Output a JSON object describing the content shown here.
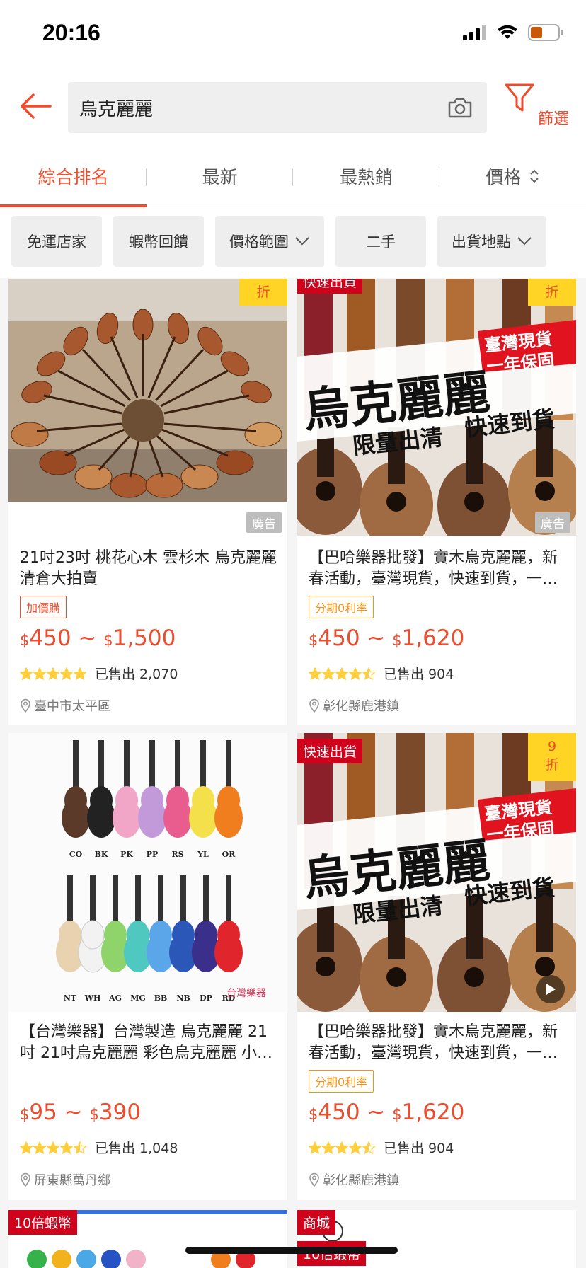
{
  "status_bar": {
    "time": "20:16"
  },
  "search": {
    "query": "烏克麗麗",
    "filter_label": "篩選"
  },
  "sort_tabs": [
    {
      "label": "綜合排名"
    },
    {
      "label": "最新"
    },
    {
      "label": "最熱銷"
    },
    {
      "label": "價格"
    }
  ],
  "chips": [
    {
      "label": "免運店家"
    },
    {
      "label": "蝦幣回饋"
    },
    {
      "label": "價格範圍"
    },
    {
      "label": "二手"
    },
    {
      "label": "出貨地點"
    }
  ],
  "products": [
    {
      "title": "21吋23吋 桃花心木 雲杉木 烏克麗麗 清倉大拍賣",
      "discount_flag": "折",
      "ad_label": "廣告",
      "tag": "加價購",
      "price_currency_1": "$",
      "price_min": "450",
      "price_sep": " ~ ",
      "price_currency_2": "$",
      "price_max": "1,500",
      "rating": 5,
      "sold": "已售出 2,070",
      "location": "臺中市太平區"
    },
    {
      "title": "【巴哈樂器批發】實木烏克麗麗，新春活動，臺灣現貨，快速到貨，一年保固",
      "top_badge": "快速出貨",
      "discount_flag": "折",
      "ad_label": "廣告",
      "banner_big": "烏克麗麗",
      "banner_red_1": "臺灣現貨",
      "banner_red_2": "一年保固",
      "banner_sub_1": "限量出清",
      "banner_sub_2": "快速到貨",
      "tag": "分期0利率",
      "price_currency_1": "$",
      "price_min": "450",
      "price_sep": " ~ ",
      "price_currency_2": "$",
      "price_max": "1,620",
      "rating": 4.5,
      "sold": "已售出 904",
      "location": "彰化縣鹿港鎮"
    },
    {
      "title": "【台灣樂器】台灣製造 烏克麗麗 21吋 21吋烏克麗麗 彩色烏克麗麗 小吉他",
      "color_codes_top": [
        "CO",
        "BK",
        "PK",
        "PP",
        "RS",
        "YL",
        "OR"
      ],
      "color_codes_bottom": [
        "NT",
        "WH",
        "AG",
        "MG",
        "BB",
        "NB",
        "DP",
        "RD"
      ],
      "brand_mark": "台灣樂器",
      "price_currency_1": "$",
      "price_min": "95",
      "price_sep": " ~ ",
      "price_currency_2": "$",
      "price_max": "390",
      "rating": 4.5,
      "sold": "已售出 1,048",
      "location": "屏東縣萬丹鄉"
    },
    {
      "title": "【巴哈樂器批發】實木烏克麗麗，新春活動，臺灣現貨，快速到貨，一年保固",
      "top_badge": "快速出貨",
      "discount_flag_num": "9",
      "discount_flag": "折",
      "banner_big": "烏克麗麗",
      "banner_red_1": "臺灣現貨",
      "banner_red_2": "一年保固",
      "banner_sub_1": "限量出清",
      "banner_sub_2": "快速到貨",
      "tag": "分期0利率",
      "price_currency_1": "$",
      "price_min": "450",
      "price_sep": " ~ ",
      "price_currency_2": "$",
      "price_max": "1,620",
      "rating": 4.5,
      "sold": "已售出 904",
      "location": "彰化縣鹿港鎮"
    },
    {
      "top_badge": "10倍蝦幣"
    },
    {
      "top_badge": "商城",
      "top_badge_2": "10倍蝦幣"
    }
  ],
  "colors": {
    "accent": "#ee4d2d",
    "discount_bg": "#ffd424",
    "badge_red": "#d0011b",
    "star": "#ffce3d"
  },
  "icons": {
    "back": "arrow-left-icon",
    "camera": "camera-icon",
    "filter": "funnel-icon",
    "sort": "sort-arrows-icon",
    "chevron": "chevron-down-icon",
    "location": "location-pin-icon",
    "play": "play-icon"
  }
}
